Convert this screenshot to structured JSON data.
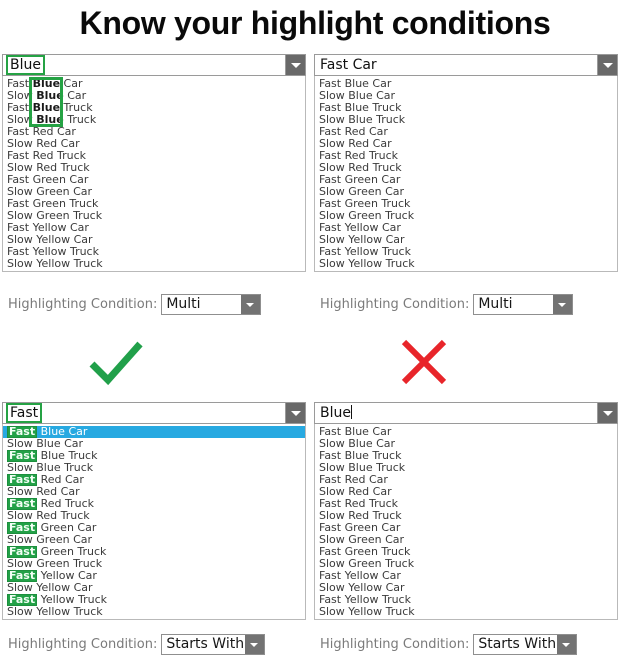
{
  "page": {
    "title": "Know your highlight conditions"
  },
  "options": [
    "Fast Blue Car",
    "Slow Blue Car",
    "Fast Blue Truck",
    "Slow Blue Truck",
    "Fast Red Car",
    "Slow Red Car",
    "Fast Red Truck",
    "Slow Red Truck",
    "Fast Green Car",
    "Slow Green Car",
    "Fast Green Truck",
    "Slow Green Truck",
    "Fast Yellow Car",
    "Slow Yellow Car",
    "Fast Yellow Truck",
    "Slow Yellow Truck"
  ],
  "colors": {
    "highlight_green": "#25a244",
    "selection_blue": "#27a9e1",
    "check_green": "#21a04a",
    "cross_red": "#e8252a",
    "label_gray": "#7a7a7a",
    "arrow_button_gray": "#696969"
  },
  "panels": {
    "top_left": {
      "input_value": "Blue",
      "input_highlight": "outline-green",
      "has_caret": false,
      "condition_label": "Highlighting Condition:",
      "condition_value": "Multi",
      "verdict": "check",
      "highlight_mode": "multi-bold-box",
      "highlighted_word": "Blue",
      "highlighted_rows": [
        0,
        1,
        2,
        3
      ],
      "selected_index": -1,
      "dropdown_arrow": "chevron-down-icon"
    },
    "top_right": {
      "input_value": "Fast Car",
      "input_highlight": "none",
      "has_caret": false,
      "condition_label": "Highlighting Condition:",
      "condition_value": "Multi",
      "verdict": "cross",
      "highlight_mode": "none",
      "highlighted_word": "",
      "highlighted_rows": [],
      "selected_index": -1,
      "dropdown_arrow": "chevron-down-icon"
    },
    "bottom_left": {
      "input_value": "Fast",
      "input_highlight": "outline-green",
      "has_caret": false,
      "condition_label": "Highlighting Condition:",
      "condition_value": "Starts With",
      "verdict": "",
      "highlight_mode": "starts-with-chip",
      "highlighted_word": "Fast",
      "highlighted_rows": [
        0,
        2,
        4,
        6,
        8,
        10,
        12,
        14
      ],
      "selected_index": 0,
      "dropdown_arrow": "chevron-down-icon"
    },
    "bottom_right": {
      "input_value": "Blue",
      "input_highlight": "none",
      "has_caret": true,
      "condition_label": "Highlighting Condition:",
      "condition_value": "Starts With",
      "verdict": "",
      "highlight_mode": "none",
      "highlighted_word": "",
      "highlighted_rows": [],
      "selected_index": -1,
      "dropdown_arrow": "chevron-down-icon"
    }
  },
  "verdicts": {
    "check_name": "check-mark-icon",
    "cross_name": "cross-mark-icon"
  }
}
